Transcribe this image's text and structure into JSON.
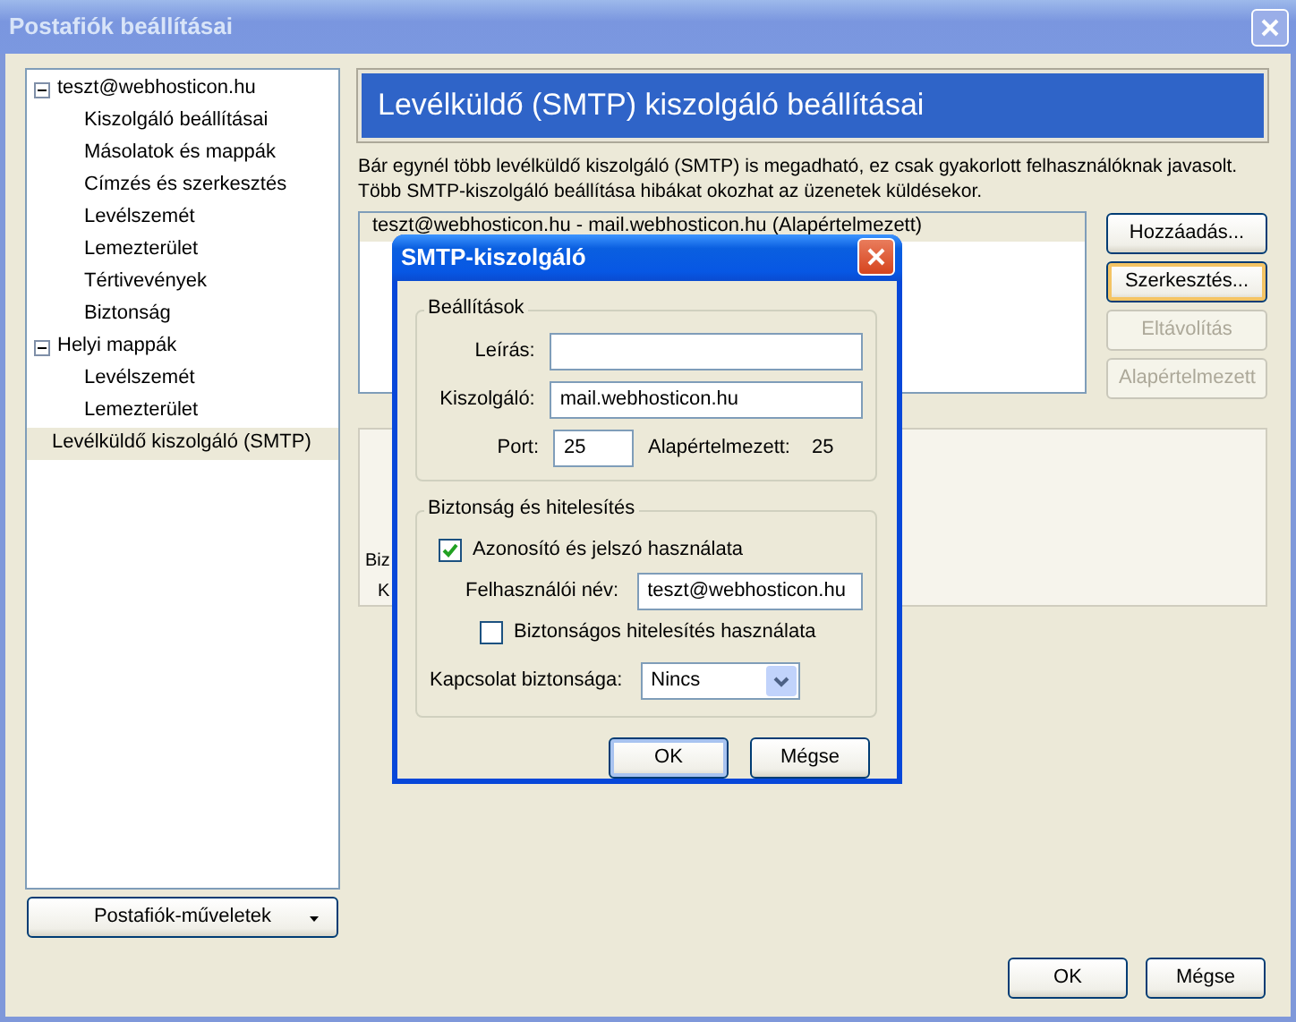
{
  "window": {
    "title": "Postafiók beállításai",
    "active": false
  },
  "tree": [
    {
      "label": "teszt@webhosticon.hu",
      "expanded": true,
      "selected": false,
      "children": [
        {
          "label": "Kiszolgáló beállításai",
          "selected": false
        },
        {
          "label": "Másolatok és mappák",
          "selected": false
        },
        {
          "label": "Címzés és szerkesztés",
          "selected": false
        },
        {
          "label": "Levélszemét",
          "selected": false
        },
        {
          "label": "Lemezterület",
          "selected": false
        },
        {
          "label": "Tértivevények",
          "selected": false
        },
        {
          "label": "Biztonság",
          "selected": false
        }
      ]
    },
    {
      "label": "Helyi mappák",
      "expanded": true,
      "selected": false,
      "children": [
        {
          "label": "Levélszemét",
          "selected": false
        },
        {
          "label": "Lemezterület",
          "selected": false
        }
      ]
    },
    {
      "label": "Levélküldő kiszolgáló (SMTP)",
      "selected": true
    }
  ],
  "account_actions_button": "Postafiók-műveletek",
  "panel": {
    "heading": "Levélküldő (SMTP) kiszolgáló beállításai",
    "description_lines": [
      "Bár egynél több levélküldő kiszolgáló (SMTP) is megadható, ez csak gyakorlott felhasználóknak javasolt.",
      "Több SMTP-kiszolgáló beállítása hibákat okozhat az üzenetek küldésekor."
    ],
    "servers": [
      {
        "label": "teszt@webhosticon.hu - mail.webhosticon.hu (Alapértelmezett)",
        "selected": true
      }
    ],
    "server_buttons": [
      {
        "label": "Hozzáadás...",
        "disabled": false,
        "focused": false
      },
      {
        "label": "Szerkesztés...",
        "disabled": false,
        "focused": true
      },
      {
        "label": "Eltávolítás",
        "disabled": true,
        "focused": false
      },
      {
        "label": "Alapértelmezett",
        "disabled": true,
        "focused": false
      }
    ],
    "details_partial": [
      "Biz",
      "K"
    ]
  },
  "buttons": [
    {
      "label": "OK"
    },
    {
      "label": "Mégse"
    }
  ],
  "smtp_dialog": {
    "title": "SMTP-kiszolgáló",
    "settings": {
      "legend": "Beállítások",
      "description_label": "Leírás:",
      "server_label": "Kiszolgáló:",
      "server_value": "mail.webhosticon.hu",
      "port_label": "Port:",
      "port_value": "25",
      "default_label": "Alapértelmezett:",
      "default_value": "25"
    },
    "security": {
      "legend": "Biztonság és hitelesítés",
      "use_auth": {
        "label": "Azonosító és jelszó használata",
        "checked": true
      },
      "username_label": "Felhasználói név:",
      "username_value": "teszt@webhosticon.hu",
      "secure_auth": {
        "label": "Biztonságos hitelesítés használata",
        "checked": false
      },
      "connection_label": "Kapcsolat biztonsága:",
      "connection_value": "Nincs"
    },
    "buttons": [
      {
        "label": "OK",
        "default": true
      },
      {
        "label": "Mégse",
        "default": false
      }
    ]
  }
}
